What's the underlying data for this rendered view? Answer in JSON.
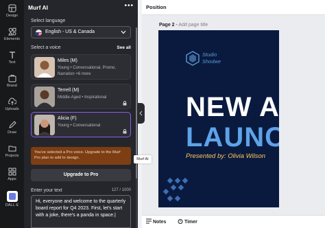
{
  "rail": {
    "items": [
      {
        "label": "Design",
        "icon": "design-icon"
      },
      {
        "label": "Elements",
        "icon": "elements-icon"
      },
      {
        "label": "Text",
        "icon": "text-icon"
      },
      {
        "label": "Brand",
        "icon": "brand-icon"
      },
      {
        "label": "Uploads",
        "icon": "uploads-icon"
      },
      {
        "label": "Draw",
        "icon": "draw-icon"
      },
      {
        "label": "Projects",
        "icon": "projects-icon"
      },
      {
        "label": "Apps",
        "icon": "apps-icon"
      },
      {
        "label": "DALL·E",
        "icon": "dalle-icon"
      }
    ]
  },
  "panel": {
    "title": "Murf AI",
    "select_language_label": "Select language",
    "language": "English - US & Canada",
    "select_voice_label": "Select a voice",
    "see_all": "See all",
    "voices": [
      {
        "name": "Miles (M)",
        "desc": "Young • Conversational, Promo, Narration +6 more"
      },
      {
        "name": "Terrell (M)",
        "desc": "Middle-Aged • Inspirational"
      },
      {
        "name": "Alicia (F)",
        "desc": "Young • Conversational"
      }
    ],
    "pro_warning": "You've selected a Pro voice. Upgrade to the Murf Pro plan to add to design.",
    "upgrade_button": "Upgrade to Pro",
    "enter_text_label": "Enter your text",
    "char_count": "127 / 1000",
    "text_value": "Hi, everyone and welcome to the quarterly board report for Q4 2023. First, let's start with a joke, there's a panda in space.|"
  },
  "tooltip": "Murf AI",
  "editor": {
    "topbar_label": "Position",
    "page_label": "Page 2",
    "page_title_placeholder": "Add page title",
    "slide": {
      "logo_line1": "Studio",
      "logo_line2": "Shodwe",
      "headline1": "NEW AF",
      "headline2": "LAUNC",
      "presented": "Presented by: Olivia Wilson"
    },
    "notes": "Notes",
    "timer": "Timer"
  },
  "colors": {
    "accent": "#8b5cf6",
    "slide_bg": "#0a1a3f",
    "slide_blue": "#5ea3e8",
    "slide_yellow": "#ffc857",
    "warn_bg": "#7c3e12"
  }
}
